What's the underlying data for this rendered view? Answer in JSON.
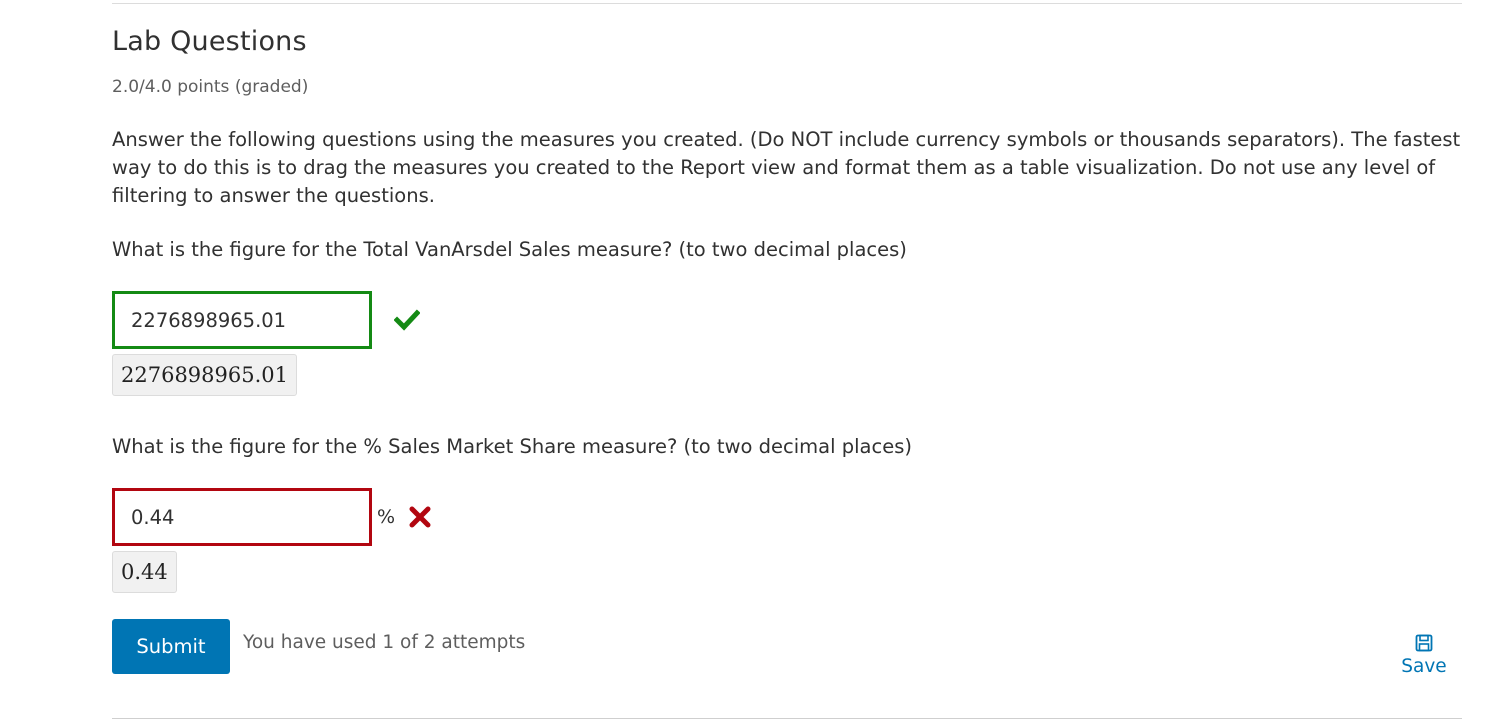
{
  "problem": {
    "title": "Lab Questions",
    "points": "2.0/4.0 points (graded)",
    "instructions": "Answer the following questions using the measures you created. (Do NOT include currency symbols or thousands separators). The fastest way to do this is to drag the measures you created to the Report view and format them as a table visualization. Do not use any level of filtering to answer the questions."
  },
  "questions": [
    {
      "text": "What is the figure for the Total VanArsdel Sales measure? (to two decimal places)",
      "value": "2276898965.01",
      "preview": "2276898965.01",
      "status": "correct",
      "unit": "",
      "status_icon": "checkmark-icon",
      "status_color": "#148a14"
    },
    {
      "text": "What is the figure for the % Sales Market Share measure? (to two decimal places)",
      "value": "0.44",
      "preview": "0.44",
      "status": "incorrect",
      "unit": "%",
      "status_icon": "cross-icon",
      "status_color": "#b20610"
    }
  ],
  "actions": {
    "submit_label": "Submit",
    "attempts_text": "You have used 1 of 2 attempts",
    "save_label": "Save",
    "save_icon": "floppy-disk-icon",
    "accent_color": "#0075b4"
  }
}
